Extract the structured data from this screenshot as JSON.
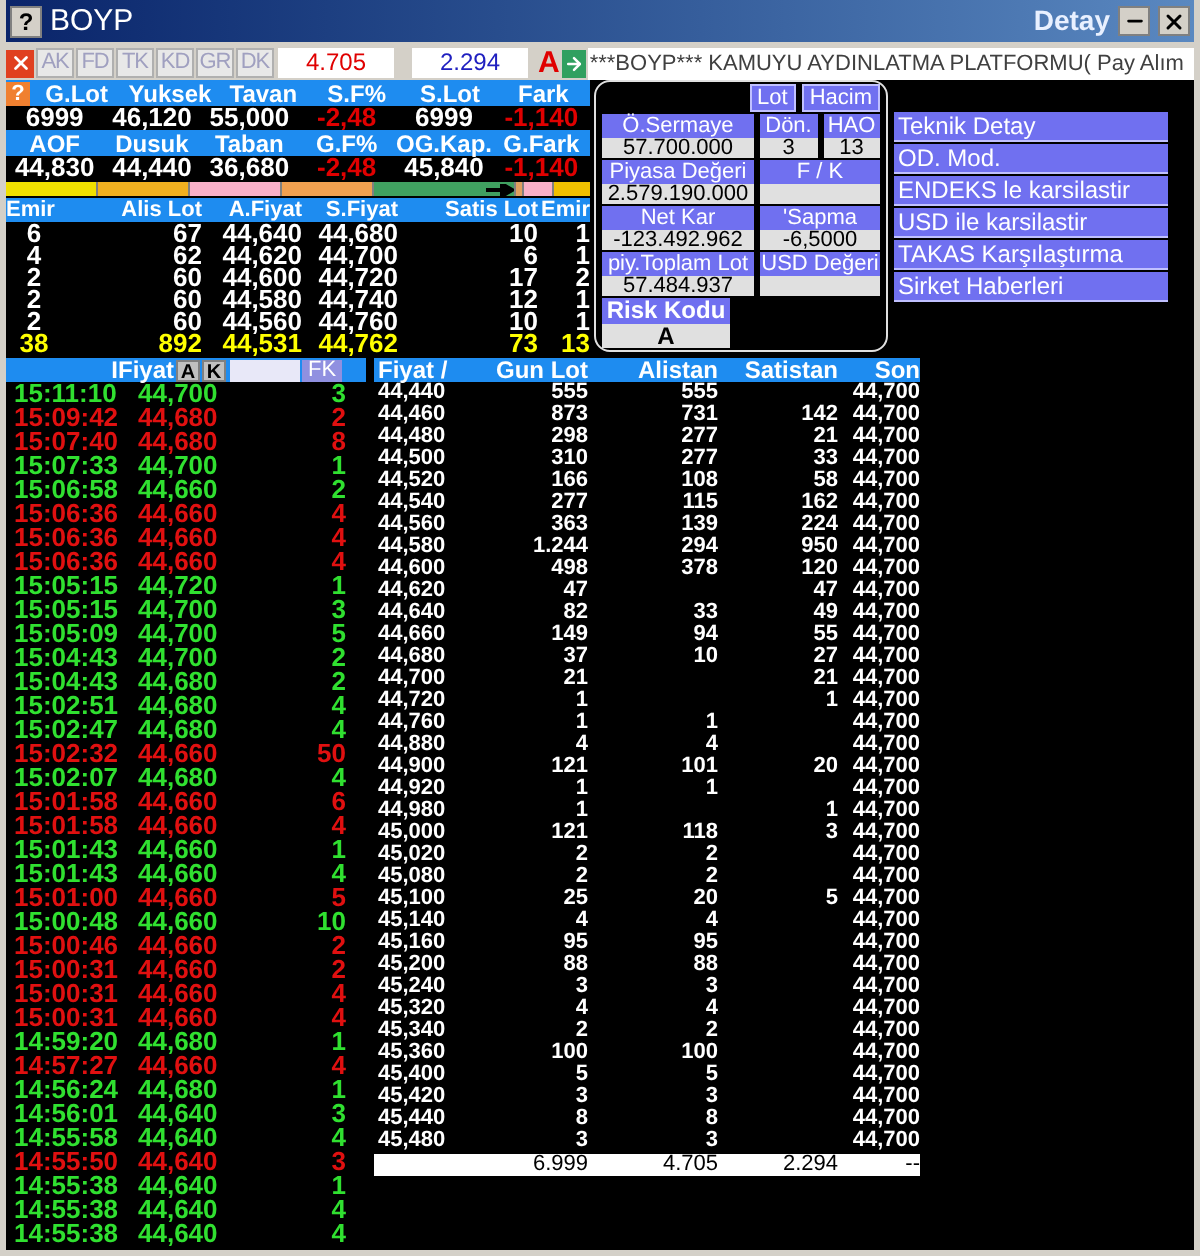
{
  "window": {
    "help": "?",
    "title": "BOYP",
    "detail_title": "Detay"
  },
  "toolbar": {
    "tabs": [
      "AK",
      "FD",
      "TK",
      "KD",
      "GR",
      "DK"
    ],
    "buy_total": "4.705",
    "sell_total": "2.294",
    "flag": "A",
    "ticker": "***BOYP*** KAMUYU AYDINLATMA PLATFORMU( Pay Alım"
  },
  "stats": {
    "help": "?",
    "groups": [
      {
        "headers": [
          "G.Lot",
          "Yuksek",
          "Tavan",
          "S.F%",
          "S.Lot",
          "Fark"
        ],
        "values": [
          {
            "text": "6999",
            "negative": false
          },
          {
            "text": "46,120",
            "negative": false
          },
          {
            "text": "55,000",
            "negative": false
          },
          {
            "text": "-2,48",
            "negative": true
          },
          {
            "text": "6999",
            "negative": false
          },
          {
            "text": "-1,140",
            "negative": true
          }
        ]
      },
      {
        "headers": [
          "AOF",
          "Dusuk",
          "Taban",
          "G.F%",
          "OG.Kap.",
          "G.Fark"
        ],
        "values": [
          {
            "text": "44,830",
            "negative": false
          },
          {
            "text": "44,440",
            "negative": false
          },
          {
            "text": "36,680",
            "negative": false
          },
          {
            "text": "-2,48",
            "negative": true
          },
          {
            "text": "45,840",
            "negative": false
          },
          {
            "text": "-1,140",
            "negative": true
          }
        ]
      }
    ]
  },
  "depth": {
    "columns": [
      "Emir",
      "Alis Lot",
      "A.Fiyat",
      "S.Fiyat",
      "Satis Lot",
      "Emir"
    ],
    "rows": [
      [
        "6",
        "67",
        "44,640",
        "44,680",
        "10",
        "1"
      ],
      [
        "4",
        "62",
        "44,620",
        "44,700",
        "6",
        "1"
      ],
      [
        "2",
        "60",
        "44,600",
        "44,720",
        "17",
        "2"
      ],
      [
        "2",
        "60",
        "44,580",
        "44,740",
        "12",
        "1"
      ],
      [
        "2",
        "60",
        "44,560",
        "44,760",
        "10",
        "1"
      ]
    ],
    "totals": [
      "38",
      "892",
      "44,531",
      "44,762",
      "73",
      "13"
    ]
  },
  "panel": {
    "toggles": [
      "Lot",
      "Hacim"
    ],
    "rows": [
      [
        {
          "label": "Ö.Sermaye",
          "value": "57.700.000"
        },
        {
          "label": "Dön.",
          "value": "3"
        },
        {
          "label": "HAO",
          "value": "13"
        }
      ],
      [
        {
          "label": "Piyasa Değeri",
          "value": "2.579.190.000"
        },
        {
          "label": "F / K"
        }
      ],
      [
        {
          "label": "Net Kar",
          "value": "-123.492.962"
        },
        {
          "label": "'Sapma",
          "value": "-6,5000"
        }
      ],
      [
        {
          "label": "piy.Toplam Lot",
          "value": "57.484.937"
        },
        {
          "label": "USD Değeri"
        }
      ]
    ],
    "risk": {
      "label": "Risk Kodu",
      "value": "A"
    }
  },
  "actions": [
    "Teknik Detay",
    "OD. Mod.",
    "ENDEKS le karsilastir",
    "USD ile karsilastir",
    "TAKAS Karşılaştırma",
    "Sirket Haberleri"
  ],
  "trades": {
    "header": "IFiyat",
    "buttons": [
      "A",
      "K"
    ],
    "filter": "FK",
    "rows": [
      {
        "time": "15:11:10",
        "price": "44,700",
        "lot": "3",
        "up": true
      },
      {
        "time": "15:09:42",
        "price": "44,680",
        "lot": "2",
        "up": false
      },
      {
        "time": "15:07:40",
        "price": "44,680",
        "lot": "8",
        "up": false
      },
      {
        "time": "15:07:33",
        "price": "44,700",
        "lot": "1",
        "up": true
      },
      {
        "time": "15:06:58",
        "price": "44,660",
        "lot": "2",
        "up": true
      },
      {
        "time": "15:06:36",
        "price": "44,660",
        "lot": "4",
        "up": false
      },
      {
        "time": "15:06:36",
        "price": "44,660",
        "lot": "4",
        "up": false
      },
      {
        "time": "15:06:36",
        "price": "44,660",
        "lot": "4",
        "up": false
      },
      {
        "time": "15:05:15",
        "price": "44,720",
        "lot": "1",
        "up": true
      },
      {
        "time": "15:05:15",
        "price": "44,700",
        "lot": "3",
        "up": true
      },
      {
        "time": "15:05:09",
        "price": "44,700",
        "lot": "5",
        "up": true
      },
      {
        "time": "15:04:43",
        "price": "44,700",
        "lot": "2",
        "up": true
      },
      {
        "time": "15:04:43",
        "price": "44,680",
        "lot": "2",
        "up": true
      },
      {
        "time": "15:02:51",
        "price": "44,680",
        "lot": "4",
        "up": true
      },
      {
        "time": "15:02:47",
        "price": "44,680",
        "lot": "4",
        "up": true
      },
      {
        "time": "15:02:32",
        "price": "44,660",
        "lot": "50",
        "up": false
      },
      {
        "time": "15:02:07",
        "price": "44,680",
        "lot": "4",
        "up": true
      },
      {
        "time": "15:01:58",
        "price": "44,660",
        "lot": "6",
        "up": false
      },
      {
        "time": "15:01:58",
        "price": "44,660",
        "lot": "4",
        "up": false
      },
      {
        "time": "15:01:43",
        "price": "44,660",
        "lot": "1",
        "up": true
      },
      {
        "time": "15:01:43",
        "price": "44,660",
        "lot": "4",
        "up": true
      },
      {
        "time": "15:01:00",
        "price": "44,660",
        "lot": "5",
        "up": false
      },
      {
        "time": "15:00:48",
        "price": "44,660",
        "lot": "10",
        "up": true
      },
      {
        "time": "15:00:46",
        "price": "44,660",
        "lot": "2",
        "up": false
      },
      {
        "time": "15:00:31",
        "price": "44,660",
        "lot": "2",
        "up": false
      },
      {
        "time": "15:00:31",
        "price": "44,660",
        "lot": "4",
        "up": false
      },
      {
        "time": "15:00:31",
        "price": "44,660",
        "lot": "4",
        "up": false
      },
      {
        "time": "14:59:20",
        "price": "44,680",
        "lot": "1",
        "up": true
      },
      {
        "time": "14:57:27",
        "price": "44,660",
        "lot": "4",
        "up": false
      },
      {
        "time": "14:56:24",
        "price": "44,680",
        "lot": "1",
        "up": true
      },
      {
        "time": "14:56:01",
        "price": "44,640",
        "lot": "3",
        "up": true
      },
      {
        "time": "14:55:58",
        "price": "44,640",
        "lot": "4",
        "up": true
      },
      {
        "time": "14:55:50",
        "price": "44,640",
        "lot": "3",
        "up": false
      },
      {
        "time": "14:55:38",
        "price": "44,640",
        "lot": "1",
        "up": true
      },
      {
        "time": "14:55:38",
        "price": "44,640",
        "lot": "4",
        "up": true
      },
      {
        "time": "14:55:38",
        "price": "44,640",
        "lot": "4",
        "up": true
      }
    ]
  },
  "price_table": {
    "columns": [
      "Fiyat /",
      "Gun Lot",
      "Alistan",
      "Satistan",
      "Son"
    ],
    "rows": [
      {
        "price": "44,440",
        "day_lot": "555",
        "buy": "555",
        "last": "44,700"
      },
      {
        "price": "44,460",
        "day_lot": "873",
        "buy": "731",
        "sell": "142",
        "last": "44,700"
      },
      {
        "price": "44,480",
        "day_lot": "298",
        "buy": "277",
        "sell": "21",
        "last": "44,700"
      },
      {
        "price": "44,500",
        "day_lot": "310",
        "buy": "277",
        "sell": "33",
        "last": "44,700"
      },
      {
        "price": "44,520",
        "day_lot": "166",
        "buy": "108",
        "sell": "58",
        "last": "44,700"
      },
      {
        "price": "44,540",
        "day_lot": "277",
        "buy": "115",
        "sell": "162",
        "last": "44,700"
      },
      {
        "price": "44,560",
        "day_lot": "363",
        "buy": "139",
        "sell": "224",
        "last": "44,700"
      },
      {
        "price": "44,580",
        "day_lot": "1.244",
        "buy": "294",
        "sell": "950",
        "last": "44,700"
      },
      {
        "price": "44,600",
        "day_lot": "498",
        "buy": "378",
        "sell": "120",
        "last": "44,700"
      },
      {
        "price": "44,620",
        "day_lot": "47",
        "sell": "47",
        "last": "44,700"
      },
      {
        "price": "44,640",
        "day_lot": "82",
        "buy": "33",
        "sell": "49",
        "last": "44,700"
      },
      {
        "price": "44,660",
        "day_lot": "149",
        "buy": "94",
        "sell": "55",
        "last": "44,700"
      },
      {
        "price": "44,680",
        "day_lot": "37",
        "buy": "10",
        "sell": "27",
        "last": "44,700"
      },
      {
        "price": "44,700",
        "day_lot": "21",
        "sell": "21",
        "last": "44,700"
      },
      {
        "price": "44,720",
        "day_lot": "1",
        "sell": "1",
        "last": "44,700"
      },
      {
        "price": "44,760",
        "day_lot": "1",
        "buy": "1",
        "last": "44,700"
      },
      {
        "price": "44,880",
        "day_lot": "4",
        "buy": "4",
        "last": "44,700"
      },
      {
        "price": "44,900",
        "day_lot": "121",
        "buy": "101",
        "sell": "20",
        "last": "44,700"
      },
      {
        "price": "44,920",
        "day_lot": "1",
        "buy": "1",
        "last": "44,700"
      },
      {
        "price": "44,980",
        "day_lot": "1",
        "sell": "1",
        "last": "44,700"
      },
      {
        "price": "45,000",
        "day_lot": "121",
        "buy": "118",
        "sell": "3",
        "last": "44,700"
      },
      {
        "price": "45,020",
        "day_lot": "2",
        "buy": "2",
        "last": "44,700"
      },
      {
        "price": "45,080",
        "day_lot": "2",
        "buy": "2",
        "last": "44,700"
      },
      {
        "price": "45,100",
        "day_lot": "25",
        "buy": "20",
        "sell": "5",
        "last": "44,700"
      },
      {
        "price": "45,140",
        "day_lot": "4",
        "buy": "4",
        "last": "44,700"
      },
      {
        "price": "45,160",
        "day_lot": "95",
        "buy": "95",
        "last": "44,700"
      },
      {
        "price": "45,200",
        "day_lot": "88",
        "buy": "88",
        "last": "44,700"
      },
      {
        "price": "45,240",
        "day_lot": "3",
        "buy": "3",
        "last": "44,700"
      },
      {
        "price": "45,320",
        "day_lot": "4",
        "buy": "4",
        "last": "44,700"
      },
      {
        "price": "45,340",
        "day_lot": "2",
        "buy": "2",
        "last": "44,700"
      },
      {
        "price": "45,360",
        "day_lot": "100",
        "buy": "100",
        "last": "44,700"
      },
      {
        "price": "45,400",
        "day_lot": "5",
        "buy": "5",
        "last": "44,700"
      },
      {
        "price": "45,420",
        "day_lot": "3",
        "buy": "3",
        "last": "44,700"
      },
      {
        "price": "45,440",
        "day_lot": "8",
        "buy": "8",
        "last": "44,700"
      },
      {
        "price": "45,480",
        "day_lot": "3",
        "buy": "3",
        "last": "44,700"
      }
    ],
    "totals": {
      "day_lot": "6.999",
      "buy": "4.705",
      "sell": "2.294",
      "last": "--"
    }
  }
}
